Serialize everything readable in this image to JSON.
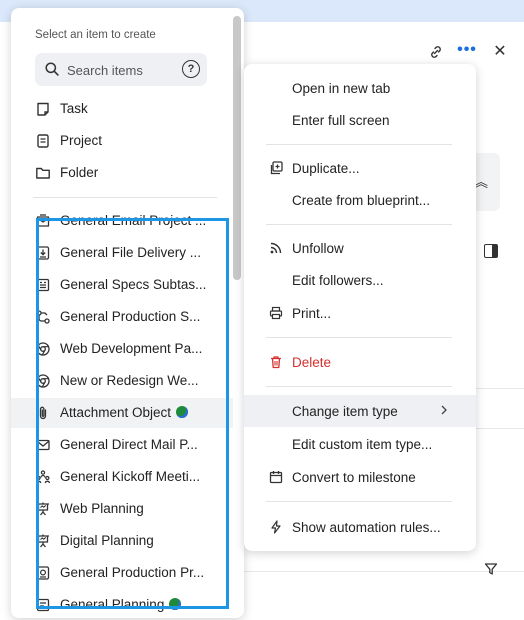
{
  "create_menu": {
    "title": "Select an item to create",
    "search": {
      "placeholder": "Search items",
      "help_symbol": "?"
    },
    "basic_items": [
      {
        "label": "Task",
        "icon": "task-icon"
      },
      {
        "label": "Project",
        "icon": "project-icon"
      },
      {
        "label": "Folder",
        "icon": "folder-icon"
      }
    ],
    "blueprint_items": [
      {
        "label": "General Email Project ...",
        "icon": "email-blueprint-icon"
      },
      {
        "label": "General File Delivery ...",
        "icon": "file-delivery-icon"
      },
      {
        "label": "General Specs Subtas...",
        "icon": "specs-icon"
      },
      {
        "label": "General Production S...",
        "icon": "production-flow-icon"
      },
      {
        "label": "Web Development Pa...",
        "icon": "chrome-icon"
      },
      {
        "label": "New or Redesign We...",
        "icon": "chrome-icon"
      },
      {
        "label": "Attachment Object",
        "icon": "paperclip-icon",
        "badge": "globe-icon"
      },
      {
        "label": "General Direct Mail P...",
        "icon": "envelope-icon"
      },
      {
        "label": "General Kickoff Meeti...",
        "icon": "team-icon"
      },
      {
        "label": "Web Planning",
        "icon": "easel-icon"
      },
      {
        "label": "Digital Planning",
        "icon": "easel-icon"
      },
      {
        "label": "General Production Pr...",
        "icon": "production-doc-icon"
      },
      {
        "label": "General Planning",
        "icon": "planning-icon",
        "badge": "globe-icon"
      }
    ]
  },
  "context_menu": {
    "items": [
      {
        "label": "Open in new tab",
        "icon": ""
      },
      {
        "label": "Enter full screen",
        "icon": ""
      },
      {
        "label": "Duplicate...",
        "icon": "duplicate-icon"
      },
      {
        "label": "Create from blueprint...",
        "icon": ""
      },
      {
        "label": "Unfollow",
        "icon": "rss-icon"
      },
      {
        "label": "Edit followers...",
        "icon": ""
      },
      {
        "label": "Print...",
        "icon": "print-icon"
      },
      {
        "label": "Delete",
        "icon": "trash-icon"
      },
      {
        "label": "Change item type",
        "icon": "",
        "submenu": true
      },
      {
        "label": "Edit custom item type...",
        "icon": ""
      },
      {
        "label": "Convert to milestone",
        "icon": "calendar-icon"
      },
      {
        "label": "Show automation rules...",
        "icon": "lightning-icon"
      }
    ]
  },
  "colors": {
    "accent": "#1e96e6",
    "danger": "#d32f2f",
    "topbar": "#dbe8fb",
    "dots": "#1a6fe0"
  },
  "background": {
    "dots_symbol": "•••",
    "close_symbol": "✕",
    "chevron_up_symbol": "︽"
  }
}
